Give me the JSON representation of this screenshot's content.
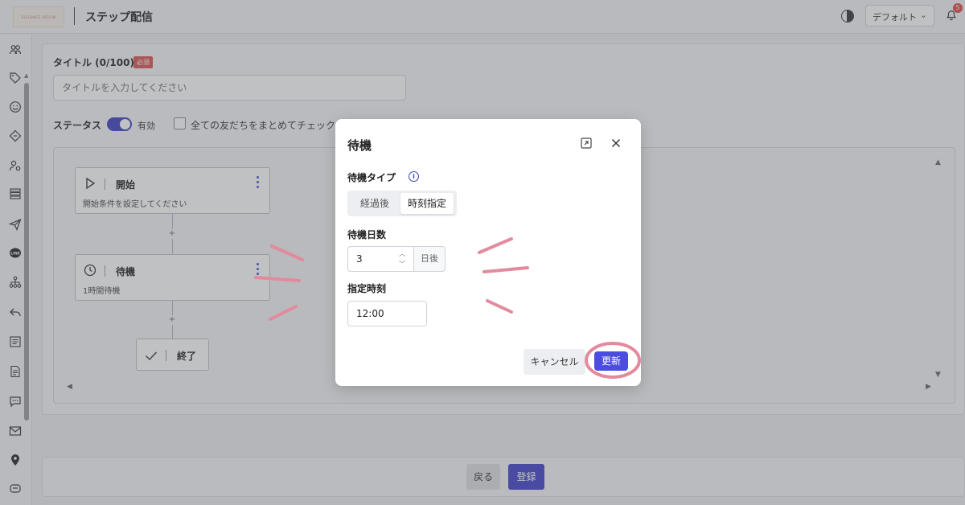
{
  "colors": {
    "accent": "#3c3fc1",
    "primary_button": "#3f40c9",
    "required_badge": "#d9534f",
    "annotation": "#e48a9e",
    "notification_badge": "#e24646"
  },
  "header": {
    "app_title": "ステップ配信",
    "logo_text": "ELEGANCE DESIGN",
    "profile_select": "デフォルト",
    "notification_count": "5",
    "icons": [
      "theme-toggle-icon",
      "chevron-down-icon",
      "bell-icon"
    ]
  },
  "sidebar": {
    "icons": [
      "friends-icon",
      "tag-icon",
      "smile-icon",
      "diamond-icon",
      "user-settings-icon",
      "list-icon",
      "send-icon",
      "line-icon",
      "hierarchy-icon",
      "reply-icon",
      "document-list-icon",
      "document-icon",
      "chat-icon",
      "mail-icon",
      "location-icon",
      "group-icon"
    ]
  },
  "form": {
    "title_label": "タイトル (0/100)",
    "required_badge": "必須",
    "title_placeholder": "タイトルを入力してください",
    "status_label": "ステータス",
    "status_toggle_text": "有効",
    "status_enabled": true,
    "checkbox_label": "全ての友だちをまとめてチェック",
    "checkbox_checked": false
  },
  "flow": {
    "start": {
      "title": "開始",
      "subtitle": "開始条件を設定してください",
      "icon": "play-icon"
    },
    "wait": {
      "title": "待機",
      "subtitle": "1時間待機",
      "icon": "clock-icon"
    },
    "end": {
      "title": "終了",
      "icon": "check-icon"
    },
    "add_label": "+"
  },
  "footer": {
    "back_label": "戻る",
    "submit_label": "登録"
  },
  "modal": {
    "title": "待機",
    "wait_type_label": "待機タイプ",
    "wait_type_options": [
      "経過後",
      "時刻指定"
    ],
    "wait_type_selected": "時刻指定",
    "wait_days_label": "待機日数",
    "wait_days_value": "3",
    "wait_days_unit": "日後",
    "time_label": "指定時刻",
    "time_value": "12:00",
    "cancel_label": "キャンセル",
    "update_label": "更新",
    "icons": [
      "expand-icon",
      "close-icon",
      "info-icon"
    ]
  }
}
